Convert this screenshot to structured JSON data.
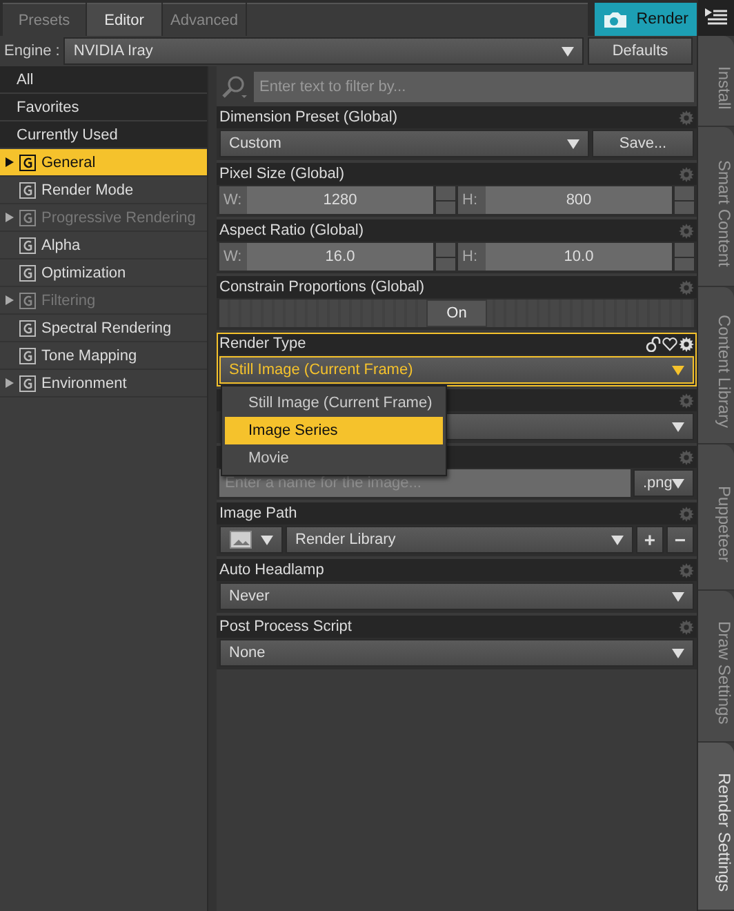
{
  "tabs": [
    {
      "label": "Presets",
      "selected": false
    },
    {
      "label": "Editor",
      "selected": true
    },
    {
      "label": "Advanced",
      "selected": false
    }
  ],
  "render_button": {
    "label": "Render"
  },
  "engine": {
    "label": "Engine :",
    "value": "NVIDIA Iray"
  },
  "defaults_button": {
    "label": "Defaults"
  },
  "sidebar": {
    "filters": [
      {
        "label": "All"
      },
      {
        "label": "Favorites"
      },
      {
        "label": "Currently Used"
      }
    ],
    "groups": [
      {
        "label": "General",
        "selected": true,
        "disabled": false,
        "expandable": true
      },
      {
        "label": "Render Mode",
        "selected": false,
        "disabled": false,
        "expandable": false
      },
      {
        "label": "Progressive Rendering",
        "selected": false,
        "disabled": true,
        "expandable": true
      },
      {
        "label": "Alpha",
        "selected": false,
        "disabled": false,
        "expandable": false
      },
      {
        "label": "Optimization",
        "selected": false,
        "disabled": false,
        "expandable": false
      },
      {
        "label": "Filtering",
        "selected": false,
        "disabled": true,
        "expandable": true
      },
      {
        "label": "Spectral Rendering",
        "selected": false,
        "disabled": false,
        "expandable": false
      },
      {
        "label": "Tone Mapping",
        "selected": false,
        "disabled": false,
        "expandable": false
      },
      {
        "label": "Environment",
        "selected": false,
        "disabled": false,
        "expandable": true
      }
    ]
  },
  "filter": {
    "placeholder": "Enter text to filter by..."
  },
  "properties": [
    {
      "kind": "preset",
      "label": "Dimension Preset (Global)",
      "value": "Custom",
      "button": "Save..."
    },
    {
      "kind": "pair",
      "label": "Pixel Size (Global)",
      "fields": [
        {
          "prefix": "W:",
          "value": "1280"
        },
        {
          "prefix": "H:",
          "value": "800"
        }
      ]
    },
    {
      "kind": "pair",
      "label": "Aspect Ratio (Global)",
      "fields": [
        {
          "prefix": "W:",
          "value": "16.0"
        },
        {
          "prefix": "H:",
          "value": "10.0"
        }
      ]
    },
    {
      "kind": "toggle",
      "label": "Constrain Proportions (Global)",
      "value": "On",
      "on": true
    },
    {
      "kind": "dropdown",
      "label": "Render Type",
      "value": "Still Image (Current Frame)",
      "focused": true,
      "options": [
        {
          "label": "Still Image (Current Frame)",
          "highlighted": false
        },
        {
          "label": "Image Series",
          "highlighted": true
        },
        {
          "label": "Movie",
          "highlighted": false
        }
      ]
    },
    {
      "kind": "dropdown"
    },
    {
      "kind": "filename",
      "placeholder": "Enter a name for the image...",
      "extension": ".png"
    },
    {
      "kind": "path",
      "label": "Image Path",
      "value": "Render Library",
      "buttons": [
        "+",
        "−"
      ]
    },
    {
      "kind": "dropdown",
      "label": "Auto Headlamp",
      "value": "Never"
    },
    {
      "kind": "dropdown",
      "label": "Post Process Script",
      "value": "None"
    }
  ],
  "side_tabs": [
    {
      "label": "Install",
      "selected": false
    },
    {
      "label": "Smart Content",
      "selected": false
    },
    {
      "label": "Content Library",
      "selected": false
    },
    {
      "label": "Puppeteer",
      "selected": false
    },
    {
      "label": "Draw Settings",
      "selected": false
    },
    {
      "label": "Render Settings",
      "selected": true
    }
  ]
}
